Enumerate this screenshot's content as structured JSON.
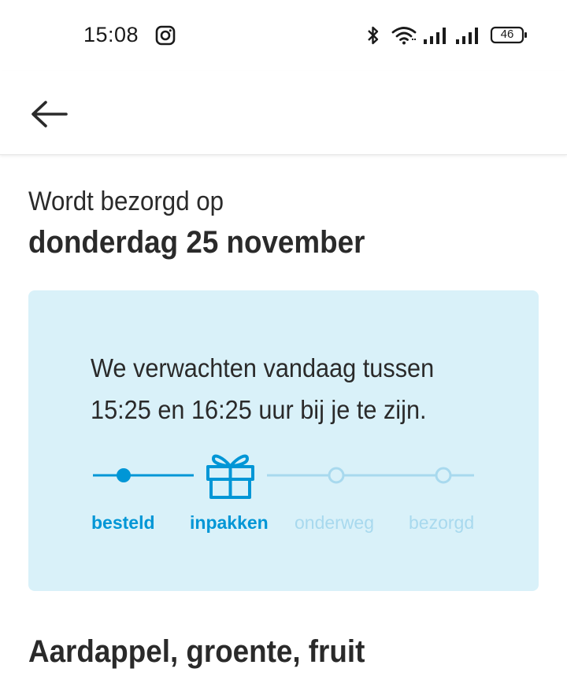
{
  "status_bar": {
    "time": "15:08",
    "battery": "46",
    "icons": [
      "instagram-icon",
      "bluetooth-icon",
      "wifi-icon",
      "signal-icon",
      "signal-icon",
      "battery-icon"
    ]
  },
  "app_bar": {
    "back_icon": "arrow-left-icon"
  },
  "delivery": {
    "line1": "Wordt bezorgd op",
    "line2": "donderdag 25 november"
  },
  "tracking": {
    "message_line1": "We verwachten vandaag tussen",
    "message_line2": "15:25 en 16:25 uur bij je te zijn.",
    "steps": [
      {
        "label": "besteld",
        "state": "done"
      },
      {
        "label": "inpakken",
        "state": "current",
        "icon": "gift-icon"
      },
      {
        "label": "onderweg",
        "state": "pending"
      },
      {
        "label": "bezorgd",
        "state": "pending"
      }
    ],
    "colors": {
      "active": "#0096d6",
      "inactive": "#a8d9ee",
      "card_bg": "#d9f1f9"
    }
  },
  "section": {
    "title": "Aardappel, groente, fruit"
  }
}
